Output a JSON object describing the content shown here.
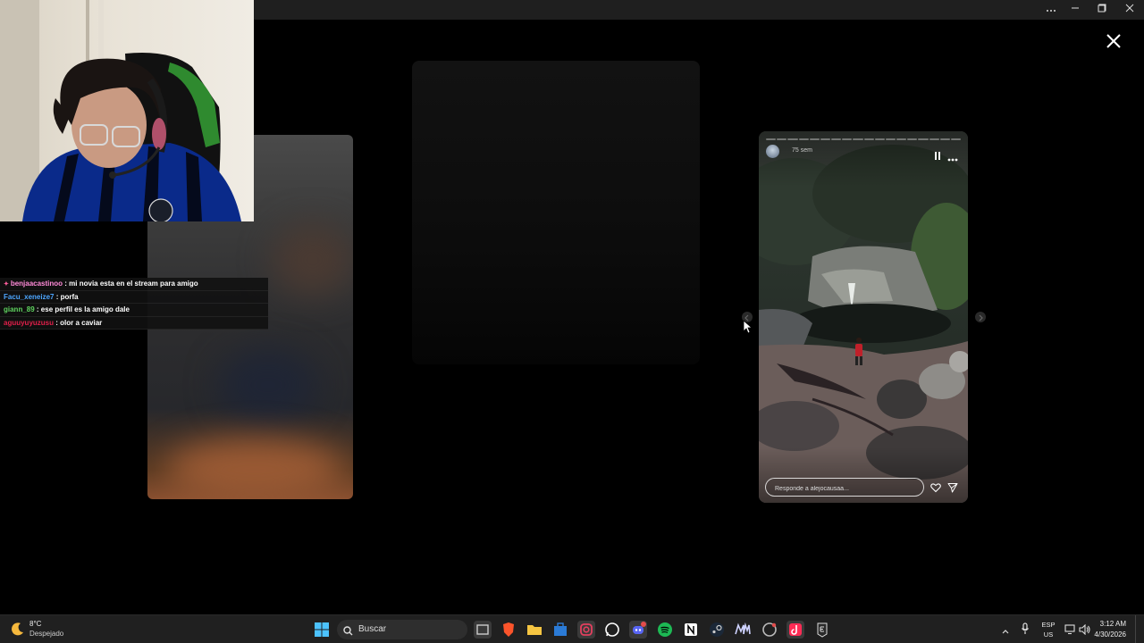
{
  "chat": {
    "messages": [
      {
        "user": "benjaacastinoo",
        "text": " : mi novia esta en el stream para amigo",
        "color": "#ff8ad8",
        "badge": true
      },
      {
        "user": "Facu_xeneize7",
        "text": " : porfa",
        "color": "#4da6ff",
        "badge": false
      },
      {
        "user": "giann_89",
        "text": " : ese perfil es la amigo dale",
        "color": "#5fd35f",
        "badge": false
      },
      {
        "user": "aguuyuyuzusu",
        "text": " : olor a caviar",
        "color": "#e0204a",
        "badge": false
      }
    ]
  },
  "story": {
    "time": "75 sem",
    "reply_placeholder": "Responde a alejocausaa...",
    "progress_segments": 18
  },
  "taskbar": {
    "weather_temp": "8°C",
    "weather_desc": "Despejado",
    "search_label": "Buscar",
    "lang_top": "ESP",
    "lang_bottom": "US",
    "time": "3:12 AM",
    "date": "4/30/2026"
  },
  "colors": {
    "accent": "#0078d4",
    "chat_panel": "#111111"
  }
}
